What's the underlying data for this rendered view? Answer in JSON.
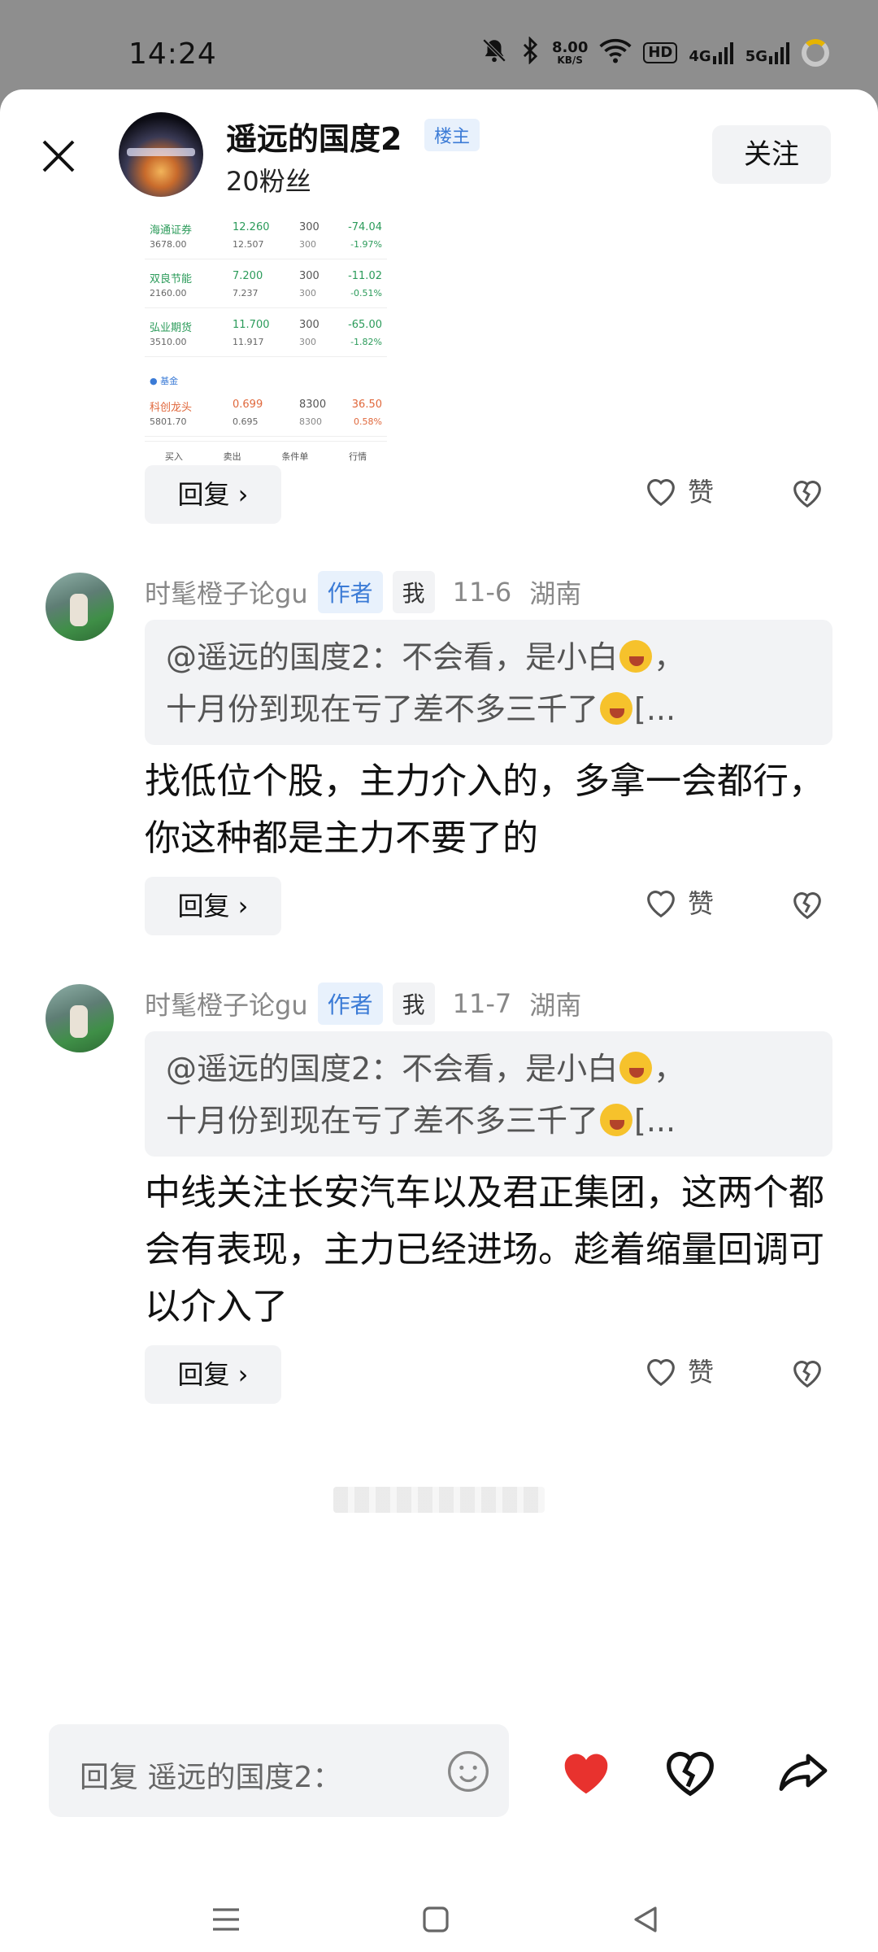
{
  "status_bar": {
    "time": "14:24",
    "net_speed_value": "8.00",
    "net_speed_unit": "KB/S",
    "hd_label": "HD",
    "net_4g": "4G",
    "net_5g": "5G"
  },
  "header": {
    "username": "遥远的国度2",
    "owner_badge": "楼主",
    "fans": "20粉丝",
    "follow_label": "关注"
  },
  "stock_image": {
    "rows": [
      {
        "name": "海通证券",
        "sub": "3678.00",
        "price": "12.260",
        "price_sub": "12.507",
        "qty": "300",
        "qty_sub": "300",
        "chg": "-74.04",
        "chg_pct": "-1.97%",
        "up": false
      },
      {
        "name": "双良节能",
        "sub": "2160.00",
        "price": "7.200",
        "price_sub": "7.237",
        "qty": "300",
        "qty_sub": "300",
        "chg": "-11.02",
        "chg_pct": "-0.51%",
        "up": false
      },
      {
        "name": "弘业期货",
        "sub": "3510.00",
        "price": "11.700",
        "price_sub": "11.917",
        "qty": "300",
        "qty_sub": "300",
        "chg": "-65.00",
        "chg_pct": "-1.82%",
        "up": false
      },
      {
        "name": "科创龙头",
        "sub": "5801.70",
        "price": "0.699",
        "price_sub": "0.695",
        "qty": "8300",
        "qty_sub": "8300",
        "chg": "36.50",
        "chg_pct": "0.58%",
        "up": true
      }
    ],
    "fund_label": "● 基金",
    "toolbar": [
      "买入",
      "卖出",
      "条件单",
      "行情"
    ]
  },
  "post_actions": {
    "reply_label": "回复 ›",
    "like_label": "赞"
  },
  "comments": [
    {
      "name": "时髦橙子论gu",
      "author_badge": "作者",
      "me_badge": "我",
      "date": "11-6",
      "location": "湖南",
      "quote_line1": "@遥远的国度2：不会看，是小白",
      "quote_line1_end": "，",
      "quote_line2": "十月份到现在亏了差不多三千了",
      "quote_line2_end": "[...",
      "text": "找低位个股，主力介入的，多拿一会都行，你这种都是主力不要了的",
      "reply_label": "回复 ›",
      "like_label": "赞"
    },
    {
      "name": "时髦橙子论gu",
      "author_badge": "作者",
      "me_badge": "我",
      "date": "11-7",
      "location": "湖南",
      "quote_line1": "@遥远的国度2：不会看，是小白",
      "quote_line1_end": "，",
      "quote_line2": "十月份到现在亏了差不多三千了",
      "quote_line2_end": "[...",
      "text": "中线关注长安汽车以及君正集团，这两个都会有表现，主力已经进场。趁着缩量回调可以介入了",
      "reply_label": "回复 ›",
      "like_label": "赞"
    }
  ],
  "bottom_bar": {
    "input_placeholder": "回复 遥远的国度2："
  },
  "colors": {
    "accent_blue": "#3b7bd6",
    "heart_red": "#e8322e",
    "chip_bg": "#f2f3f5"
  }
}
